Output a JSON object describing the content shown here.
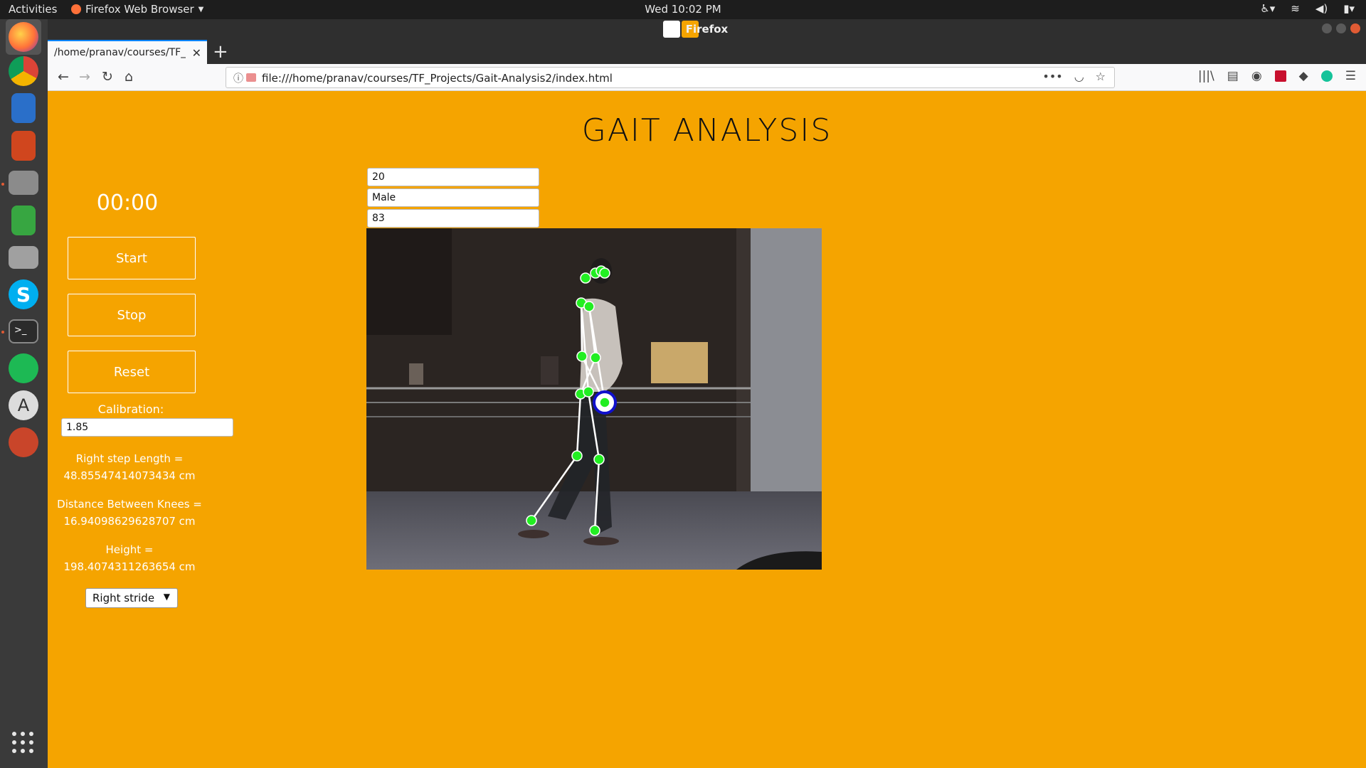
{
  "os": {
    "activities": "Activities",
    "app_menu": "Firefox Web Browser",
    "clock": "Wed 10:02 PM"
  },
  "window": {
    "title": "Firefox"
  },
  "browser": {
    "tab_title": "/home/pranav/courses/TF_P",
    "url": "file:///home/pranav/courses/TF_Projects/Gait-Analysis2/index.html"
  },
  "page": {
    "title": "GAIT ANALYSIS",
    "timer": "00:00",
    "buttons": {
      "start": "Start",
      "stop": "Stop",
      "reset": "Reset"
    },
    "calibration_label": "Calibration:",
    "calibration_value": "1.85",
    "metrics": {
      "right_step_label": "Right step Length =",
      "right_step_value": "48.85547414073434 cm",
      "knees_label": "Distance Between Knees =",
      "knees_value": "16.94098629628707 cm",
      "height_label": "Height =",
      "height_value": "198.4074311263654 cm"
    },
    "stride_select": "Right stride",
    "inputs": {
      "age": "20",
      "gender": "Male",
      "weight": "83"
    }
  },
  "colors": {
    "page_bg": "#f5a400",
    "keypoint": "#22dd22",
    "skeleton": "#ffffff",
    "selected_keypoint": "#1010cc"
  }
}
